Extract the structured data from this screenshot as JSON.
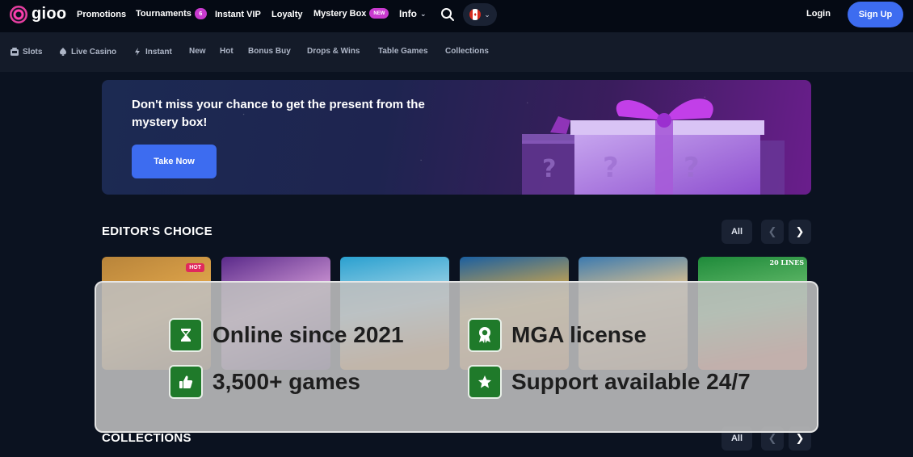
{
  "header": {
    "logo_text": "gioo",
    "nav": [
      {
        "label": "Promotions"
      },
      {
        "label": "Tournaments",
        "badge": "6"
      },
      {
        "label": "Instant VIP"
      },
      {
        "label": "Loyalty"
      },
      {
        "label": "Mystery Box",
        "badge": "NEW"
      },
      {
        "label": "Info"
      }
    ],
    "login_label": "Login",
    "signup_label": "Sign Up",
    "colors": {
      "primary": "#3d6cf0",
      "badge": "#c93acf"
    }
  },
  "categories": [
    {
      "label": "Slots",
      "icon": "slot-machine-icon"
    },
    {
      "label": "Live Casino",
      "icon": "spade-icon"
    },
    {
      "label": "Instant",
      "icon": "lightning-icon"
    },
    {
      "label": "New"
    },
    {
      "label": "Hot"
    },
    {
      "label": "Bonus Buy"
    },
    {
      "label": "Drops & Wins"
    },
    {
      "label": "Table Games"
    },
    {
      "label": "Collections"
    }
  ],
  "banner": {
    "title": "Don't miss your chance to get the present from the mystery box!",
    "button_label": "Take Now"
  },
  "editors_choice": {
    "title": "EDITOR'S CHOICE",
    "all_label": "All",
    "games": [
      {
        "badge": "HOT"
      },
      {},
      {},
      {},
      {},
      {
        "badge": "20 LINES"
      }
    ]
  },
  "collections": {
    "title": "COLLECTIONS",
    "all_label": "All"
  },
  "features_overlay": {
    "items": [
      {
        "text": "Online since 2021",
        "icon": "hourglass-icon"
      },
      {
        "text": "MGA license",
        "icon": "award-icon"
      },
      {
        "text": "3,500+ games",
        "icon": "thumbs-up-icon"
      },
      {
        "text": "Support available 24/7",
        "icon": "star-icon"
      }
    ],
    "icon_bg": "#1f7a2a"
  }
}
